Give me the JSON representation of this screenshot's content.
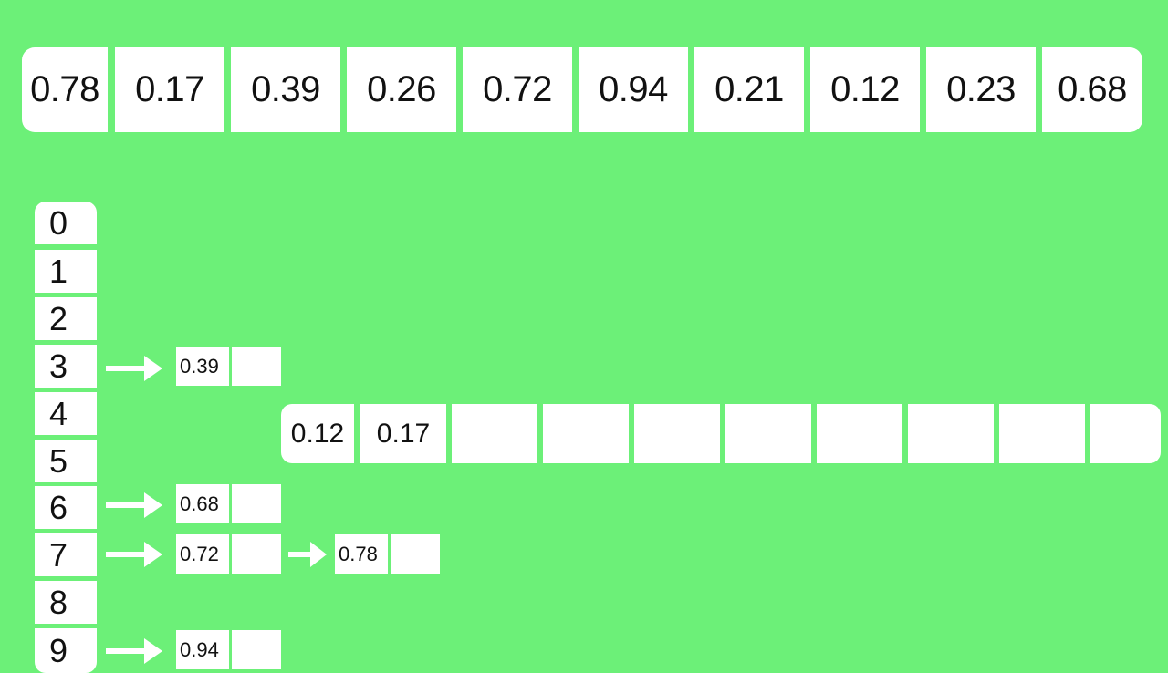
{
  "input_array": [
    "0.78",
    "0.17",
    "0.39",
    "0.26",
    "0.72",
    "0.94",
    "0.21",
    "0.12",
    "0.23",
    "0.68"
  ],
  "bucket_indices": [
    "0",
    "1",
    "2",
    "3",
    "4",
    "5",
    "6",
    "7",
    "8",
    "9"
  ],
  "buckets": {
    "b3": [
      "0.39"
    ],
    "b6": [
      "0.68"
    ],
    "b7": [
      "0.72",
      "0.78"
    ],
    "b9": [
      "0.94"
    ]
  },
  "output_array": [
    "0.12",
    "0.17",
    "",
    "",
    "",
    "",
    "",
    "",
    "",
    ""
  ],
  "colors": {
    "background": "#6cf078",
    "cell": "#ffffff",
    "arrow": "#ffffff",
    "text": "#111111"
  }
}
